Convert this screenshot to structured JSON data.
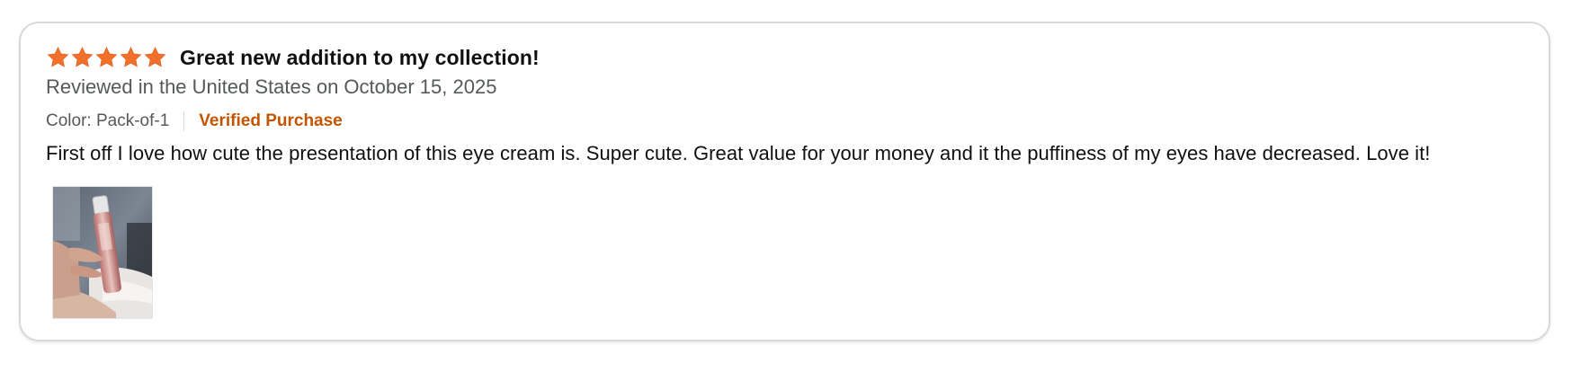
{
  "review": {
    "rating": 5,
    "rating_max": 5,
    "star_color": "#f1702b",
    "title": "Great new addition to my collection!",
    "date_line": "Reviewed in the United States on October 15, 2025",
    "variant": "Color: Pack-of-1",
    "verified_label": "Verified Purchase",
    "body": "First off I love how cute the presentation of this eye cream is. Super cute. Great value for your money and it the puffiness of my eyes have decreased. Love it!",
    "image_icon": "review-photo-thumbnail"
  },
  "colors": {
    "verified": "#c45500",
    "secondary_text": "#565959",
    "border": "#d5d9d9"
  }
}
